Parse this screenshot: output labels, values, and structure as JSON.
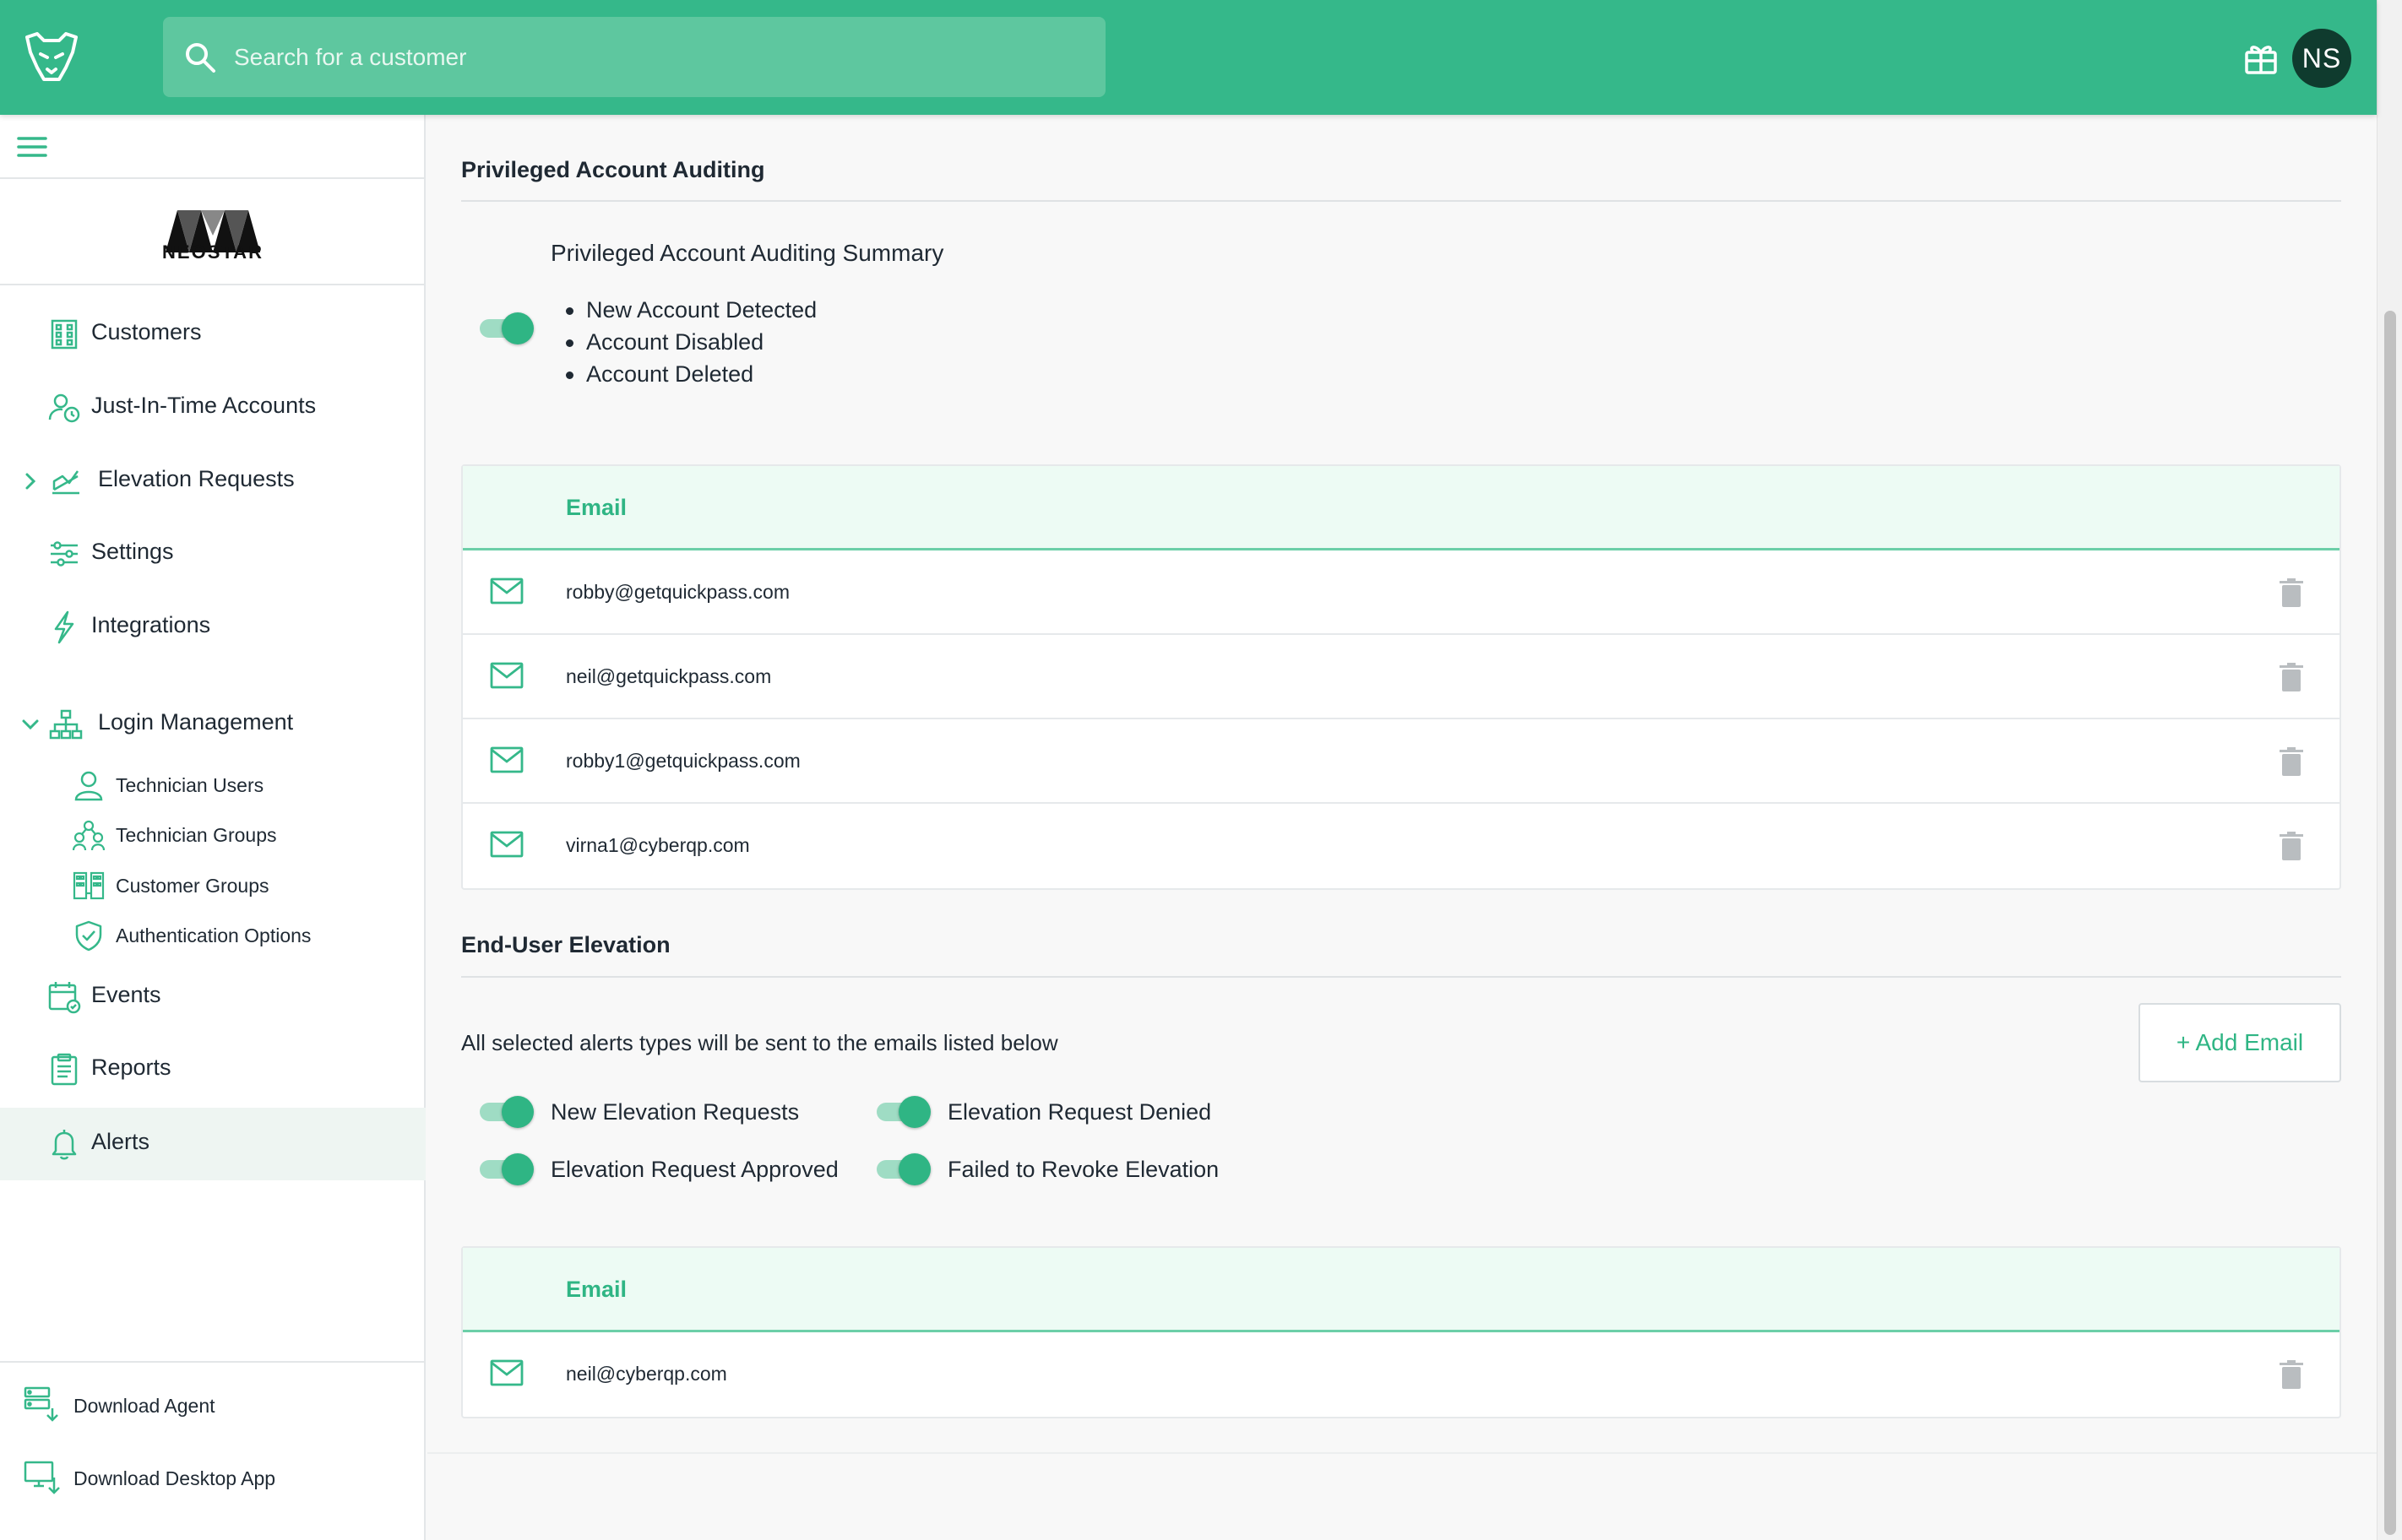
{
  "topbar": {
    "search_placeholder": "Search for a customer",
    "avatar_initials": "NS",
    "accent_color": "#35b88a"
  },
  "sidebar": {
    "brand_name": "NEOSTAR",
    "items": [
      {
        "label": "Customers",
        "icon": "building-icon"
      },
      {
        "label": "Just-In-Time Accounts",
        "icon": "user-clock-icon"
      },
      {
        "label": "Elevation Requests",
        "icon": "chart-icon",
        "expandable": true,
        "expanded": false
      },
      {
        "label": "Settings",
        "icon": "sliders-icon"
      },
      {
        "label": "Integrations",
        "icon": "lightning-icon"
      },
      {
        "label": "Login Management",
        "icon": "org-chart-icon",
        "expandable": true,
        "expanded": true
      },
      {
        "label": "Events",
        "icon": "calendar-icon"
      },
      {
        "label": "Reports",
        "icon": "clipboard-icon"
      },
      {
        "label": "Alerts",
        "icon": "bell-icon",
        "active": true
      }
    ],
    "sub_items": [
      {
        "label": "Technician Users",
        "icon": "user-icon"
      },
      {
        "label": "Technician Groups",
        "icon": "users-icon"
      },
      {
        "label": "Customer Groups",
        "icon": "building-group-icon"
      },
      {
        "label": "Authentication Options",
        "icon": "shield-check-icon"
      }
    ],
    "downloads": [
      {
        "label": "Download Agent",
        "icon": "server-download-icon"
      },
      {
        "label": "Download Desktop App",
        "icon": "monitor-download-icon"
      }
    ]
  },
  "privileged": {
    "title": "Privileged Account Auditing",
    "summary_title": "Privileged Account Auditing Summary",
    "summary_enabled": true,
    "bullets": [
      "New Account Detected",
      "Account Disabled",
      "Account Deleted"
    ],
    "table_header": "Email",
    "emails": [
      "robby@getquickpass.com",
      "neil@getquickpass.com",
      "robby1@getquickpass.com",
      "virna1@cyberqp.com"
    ]
  },
  "elevation": {
    "title": "End-User Elevation",
    "info": "All selected alerts types will be sent to the emails listed below",
    "add_email_label": "+ Add Email",
    "options": [
      {
        "label": "New Elevation Requests",
        "enabled": true
      },
      {
        "label": "Elevation Request Denied",
        "enabled": true
      },
      {
        "label": "Elevation Request Approved",
        "enabled": true
      },
      {
        "label": "Failed to Revoke Elevation",
        "enabled": true
      }
    ],
    "table_header": "Email",
    "emails": [
      "neil@cyberqp.com"
    ]
  }
}
